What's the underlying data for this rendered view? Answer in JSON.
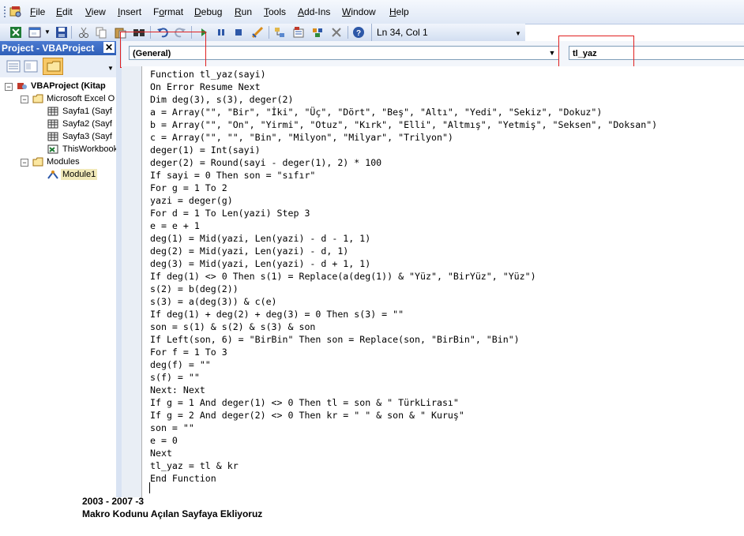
{
  "menu": {
    "items": [
      {
        "label": "File",
        "accel": "F",
        "rest": "ile"
      },
      {
        "label": "Edit",
        "accel": "E",
        "rest": "dit"
      },
      {
        "label": "View",
        "accel": "V",
        "rest": "iew"
      },
      {
        "label": "Insert",
        "accel": "I",
        "rest": "nsert"
      },
      {
        "label": "Format",
        "accel": "o",
        "pre": "F",
        "rest": "rmat"
      },
      {
        "label": "Debug",
        "accel": "D",
        "rest": "ebug"
      },
      {
        "label": "Run",
        "accel": "R",
        "rest": "un"
      },
      {
        "label": "Tools",
        "accel": "T",
        "rest": "ools"
      },
      {
        "label": "Add-Ins",
        "accel": "A",
        "rest": "dd-Ins"
      },
      {
        "label": "Window",
        "accel": "W",
        "rest": "indow"
      },
      {
        "label": "Help",
        "accel": "H",
        "rest": "elp"
      }
    ]
  },
  "toolbar": {
    "cursor_position": "Ln 34, Col 1",
    "icons": [
      "excel-icon",
      "insert-userform-icon",
      "save-icon",
      "cut-icon",
      "copy-icon",
      "paste-icon",
      "find-icon",
      "undo-icon",
      "redo-icon",
      "run-icon",
      "break-icon",
      "reset-icon",
      "design-mode-icon",
      "project-explorer-icon",
      "properties-icon",
      "object-browser-icon",
      "toolbox-icon",
      "help-icon"
    ]
  },
  "project": {
    "title": "Project - VBAProject",
    "tree": {
      "root": "VBAProject (Kitap",
      "excel_folder": "Microsoft Excel O",
      "sheets": [
        "Sayfa1 (Sayf",
        "Sayfa2 (Sayf",
        "Sayfa3 (Sayf"
      ],
      "workbook": "ThisWorkbook",
      "modules_folder": "Modules",
      "module": "Module1"
    }
  },
  "code": {
    "object_combo": "(General)",
    "procedure_combo": "tl_yaz",
    "lines": [
      "Function tl_yaz(sayi)",
      "On Error Resume Next",
      "Dim deg(3), s(3), deger(2)",
      "a = Array(\"\", \"Bir\", \"İki\", \"Üç\", \"Dört\", \"Beş\", \"Altı\", \"Yedi\", \"Sekiz\", \"Dokuz\")",
      "b = Array(\"\", \"On\", \"Yirmi\", \"Otuz\", \"Kırk\", \"Elli\", \"Altmış\", \"Yetmiş\", \"Seksen\", \"Doksan\")",
      "c = Array(\"\", \"\", \"Bin\", \"Milyon\", \"Milyar\", \"Trilyon\")",
      "deger(1) = Int(sayi)",
      "deger(2) = Round(sayi - deger(1), 2) * 100",
      "If sayi = 0 Then son = \"sıfır\"",
      "For g = 1 To 2",
      "yazi = deger(g)",
      "For d = 1 To Len(yazi) Step 3",
      "e = e + 1",
      "deg(1) = Mid(yazi, Len(yazi) - d - 1, 1)",
      "deg(2) = Mid(yazi, Len(yazi) - d, 1)",
      "deg(3) = Mid(yazi, Len(yazi) - d + 1, 1)",
      "If deg(1) <> 0 Then s(1) = Replace(a(deg(1)) & \"Yüz\", \"BirYüz\", \"Yüz\")",
      "s(2) = b(deg(2))",
      "s(3) = a(deg(3)) & c(e)",
      "If deg(1) + deg(2) + deg(3) = 0 Then s(3) = \"\"",
      "son = s(1) & s(2) & s(3) & son",
      "If Left(son, 6) = \"BirBin\" Then son = Replace(son, \"BirBin\", \"Bin\")",
      "For f = 1 To 3",
      "deg(f) = \"\"",
      "s(f) = \"\"",
      "Next: Next",
      "If g = 1 And deger(1) <> 0 Then tl = son & \" TürkLirası\"",
      "If g = 2 And deger(2) <> 0 Then kr = \" \" & son & \" Kuruş\"",
      "son = \"\"",
      "e = 0",
      "Next",
      "tl_yaz = tl & kr",
      "End Function"
    ]
  },
  "caption": {
    "line1": "2003 - 2007 -3",
    "line2": "Makro Kodunu Açılan Sayfaya Ekliyoruz"
  }
}
